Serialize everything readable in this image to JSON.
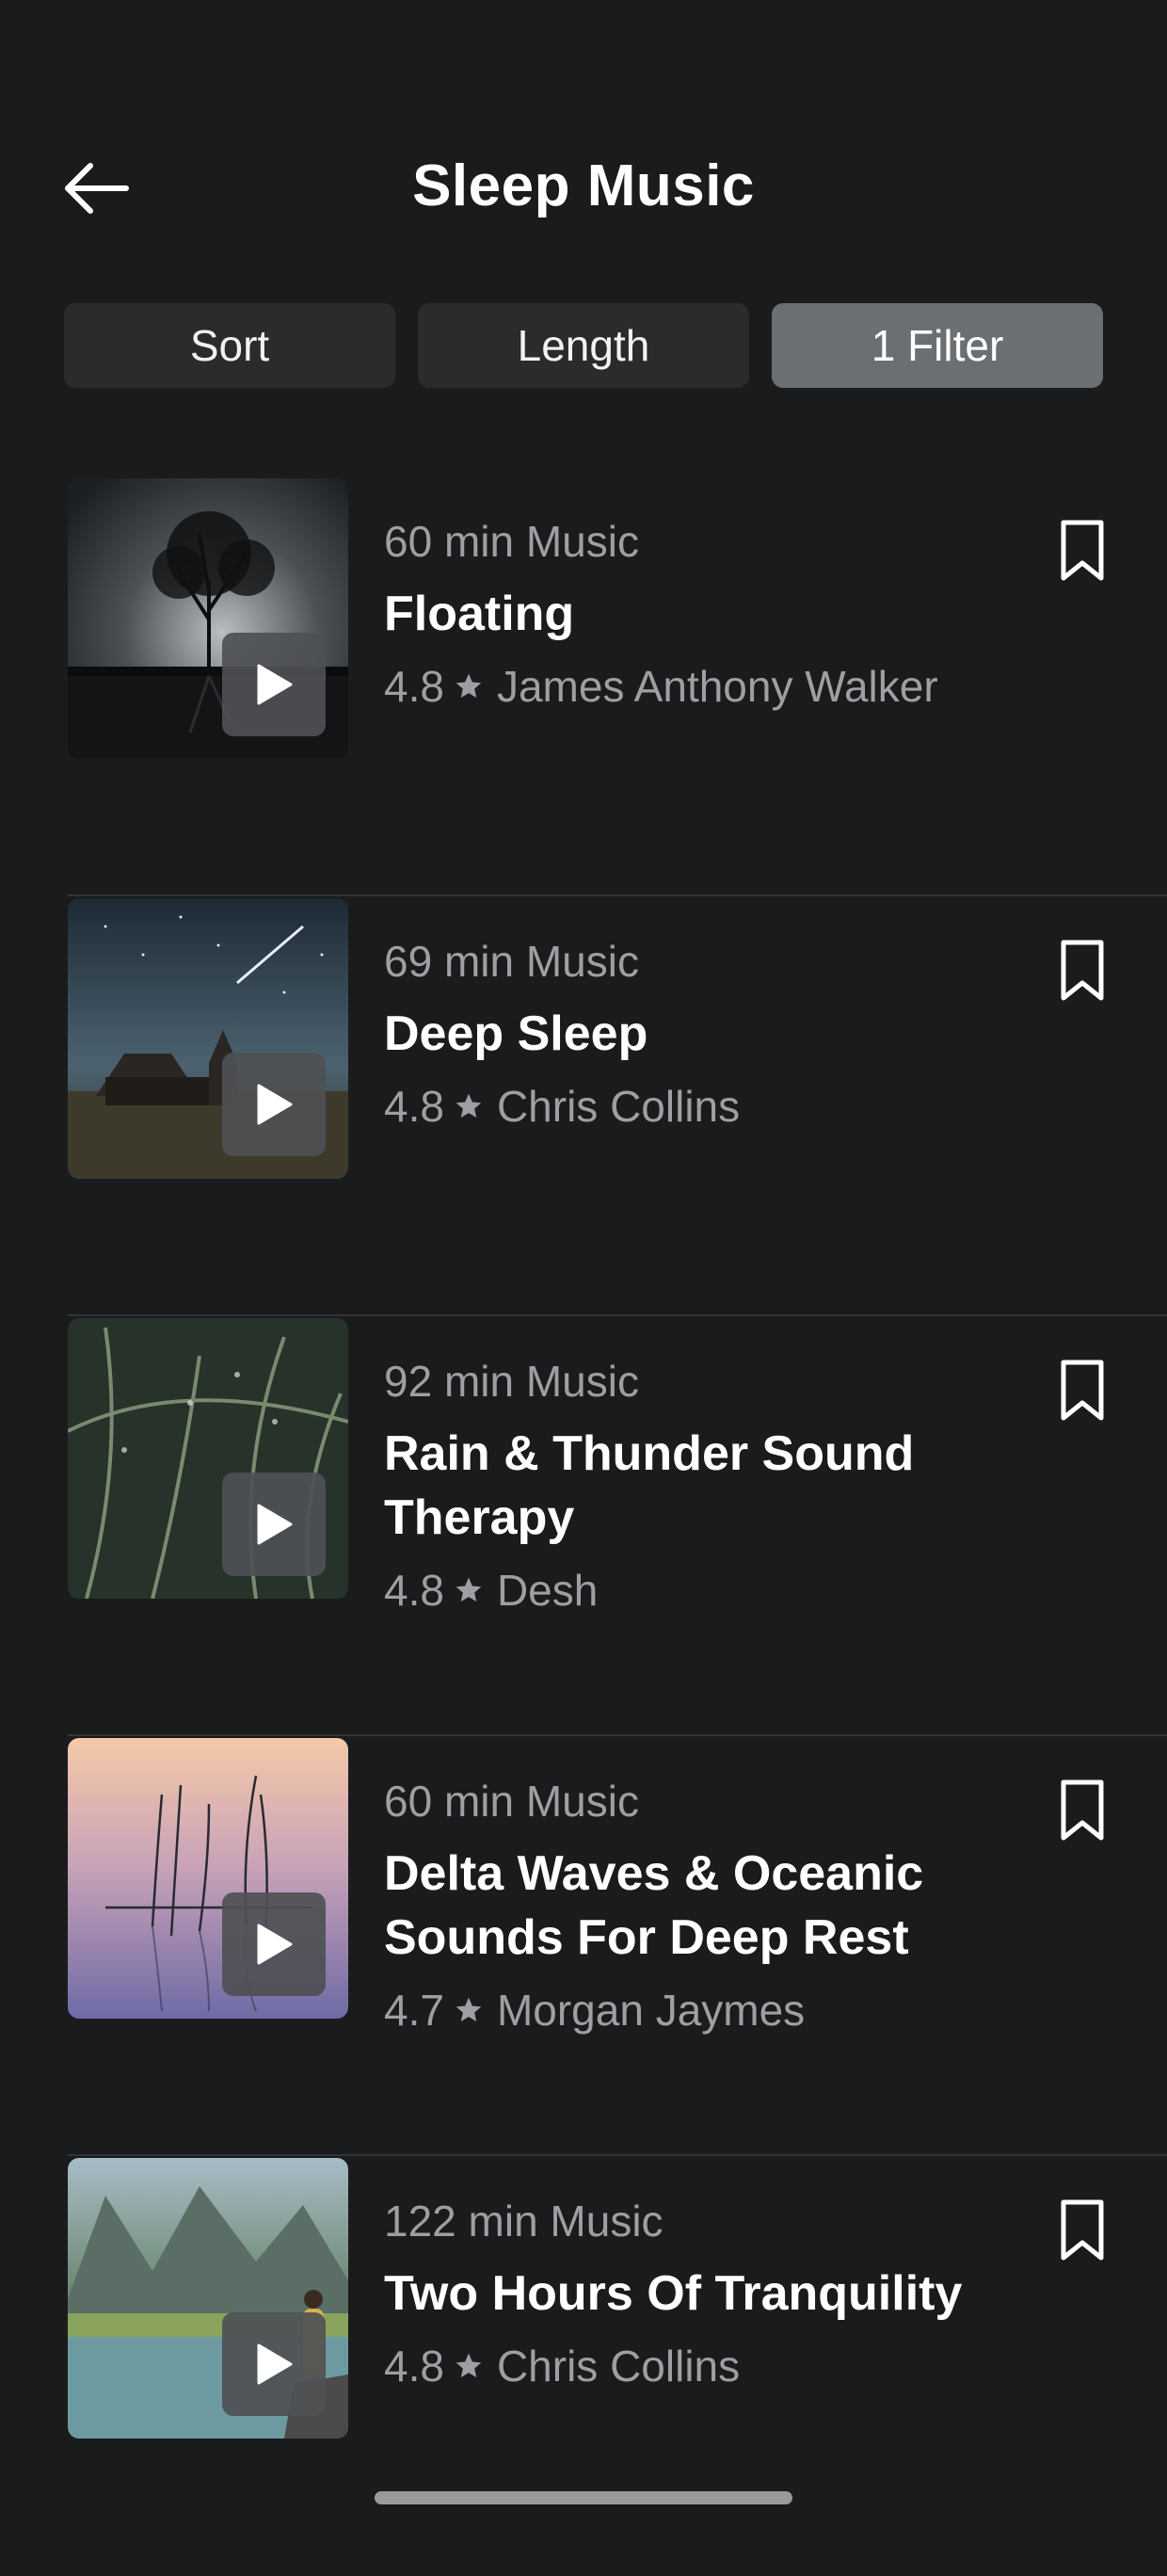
{
  "header": {
    "title": "Sleep Music",
    "back_icon": "arrow-left-icon"
  },
  "filters": {
    "sort_label": "Sort",
    "length_label": "Length",
    "filter_label": "1 Filter"
  },
  "colors": {
    "background": "#1a1b1c",
    "chip": "#2a2b2d",
    "chip_active": "#6b6f72",
    "secondary_text": "#9d9fa2"
  },
  "items": [
    {
      "duration": "60 min Music",
      "title": "Floating",
      "rating": "4.8",
      "author": "James Anthony Walker"
    },
    {
      "duration": "69 min Music",
      "title": "Deep Sleep",
      "rating": "4.8",
      "author": "Chris Collins"
    },
    {
      "duration": "92 min Music",
      "title": "Rain & Thunder Sound Therapy",
      "rating": "4.8",
      "author": "Desh"
    },
    {
      "duration": "60 min Music",
      "title": "Delta Waves & Oceanic Sounds For Deep Rest",
      "rating": "4.7",
      "author": "Morgan Jaymes"
    },
    {
      "duration": "122 min Music",
      "title": "Two Hours Of Tranquility",
      "rating": "4.8",
      "author": "Chris Collins"
    }
  ]
}
